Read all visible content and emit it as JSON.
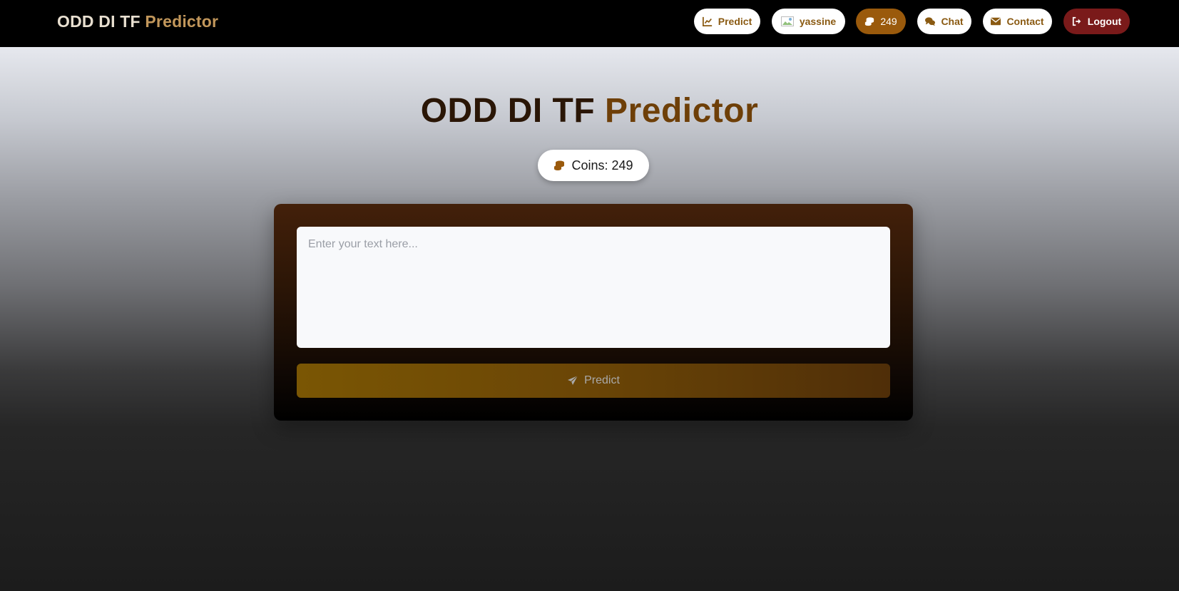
{
  "navbar": {
    "brand_part1": "ODD DI TF",
    "brand_part2": "Predictor",
    "predict_label": "Predict",
    "username": "yassine",
    "coins": "249",
    "chat_label": "Chat",
    "contact_label": "Contact",
    "logout_label": "Logout"
  },
  "hero": {
    "title_part1": "ODD DI TF",
    "title_part2": "Predictor",
    "coins_label": "Coins: 249"
  },
  "form": {
    "placeholder": "Enter your text here...",
    "value": "",
    "submit_label": "Predict"
  },
  "colors": {
    "accent": "#9a5a0c",
    "logout": "#7a1a1a",
    "brand_gold": "#c2975b"
  },
  "icons": [
    "chart-line-icon",
    "avatar-icon",
    "coins-icon",
    "comments-icon",
    "envelope-icon",
    "sign-out-icon",
    "paper-plane-icon"
  ]
}
